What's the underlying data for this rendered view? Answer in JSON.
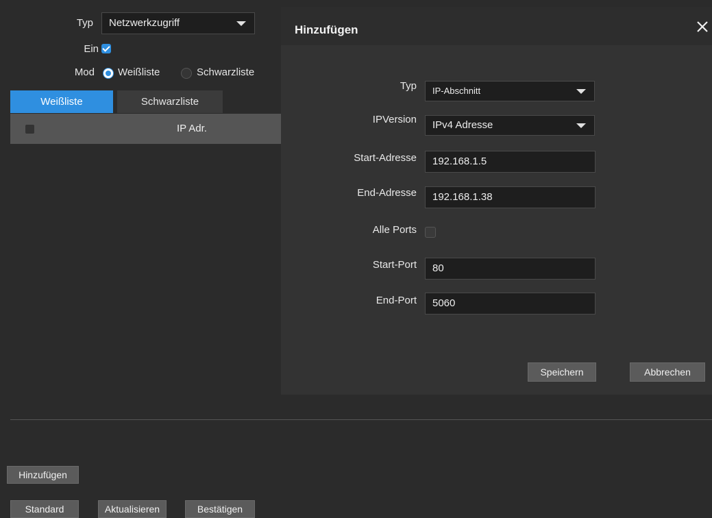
{
  "filter": {
    "type_label": "Typ",
    "type_value": "Netzwerkzugriff",
    "enable_label": "Ein",
    "mode_label": "Mod",
    "mode_options": [
      "Weißliste",
      "Schwarzliste"
    ]
  },
  "tabs": [
    "Weißliste",
    "Schwarzliste"
  ],
  "table": {
    "column_ip": "IP Adr."
  },
  "buttons": {
    "add": "Hinzufügen",
    "default": "Standard",
    "refresh": "Aktualisieren",
    "confirm": "Bestätigen"
  },
  "dialog": {
    "title": "Hinzufügen",
    "close_icon": "close-icon",
    "fields": {
      "type_label": "Typ",
      "type_value": "IP-Abschnitt",
      "ipversion_label": "IPVersion",
      "ipversion_value": "IPv4 Adresse",
      "start_address_label": "Start-Adresse",
      "start_address_value": "192.168.1.5",
      "end_address_label": "End-Adresse",
      "end_address_value": "192.168.1.38",
      "all_ports_label": "Alle Ports",
      "start_port_label": "Start-Port",
      "start_port_value": "80",
      "end_port_label": "End-Port",
      "end_port_value": "5060"
    },
    "save": "Speichern",
    "cancel": "Abbrechen"
  },
  "colors": {
    "accent": "#2f8fe0",
    "background": "#2b2b2b",
    "dialog": "#333333",
    "table_header": "#555555"
  }
}
